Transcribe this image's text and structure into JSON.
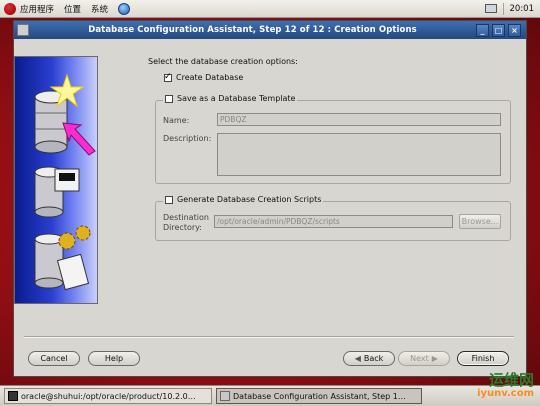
{
  "top_panel": {
    "menus": [
      "应用程序",
      "位置",
      "系统"
    ],
    "clock": "20:01"
  },
  "window": {
    "title": "Database Configuration Assistant, Step 12 of 12 : Creation Options",
    "controls": [
      "minimize",
      "maximize",
      "close"
    ]
  },
  "options": {
    "prompt": "Select the database creation options:",
    "create_database": {
      "label": "Create Database",
      "checked": true
    },
    "save_template": {
      "label": "Save as a Database Template",
      "checked": false,
      "name_label": "Name:",
      "name_value": "PDBQZ",
      "description_label": "Description:",
      "description_value": ""
    },
    "generate_scripts": {
      "label": "Generate Database Creation Scripts",
      "checked": false,
      "dest_label_1": "Destination",
      "dest_label_2": "Directory:",
      "dest_value": "/opt/oracle/admin/PDBQZ/scripts",
      "browse_label": "Browse..."
    }
  },
  "buttons": {
    "cancel": "Cancel",
    "help": "Help",
    "back": "Back",
    "next": "Next",
    "finish": "Finish"
  },
  "taskbar": {
    "tasks": [
      "oracle@shuhui:/opt/oracle/product/10.2.0…",
      "Database Configuration Assistant, Step 1…"
    ]
  },
  "watermark": {
    "line1": "运维网",
    "line2": "iyunv.com"
  },
  "colors": {
    "title_bar": "#2f5c9c",
    "desktop": "#a3121a",
    "art_blue": "#2a3fd0"
  }
}
